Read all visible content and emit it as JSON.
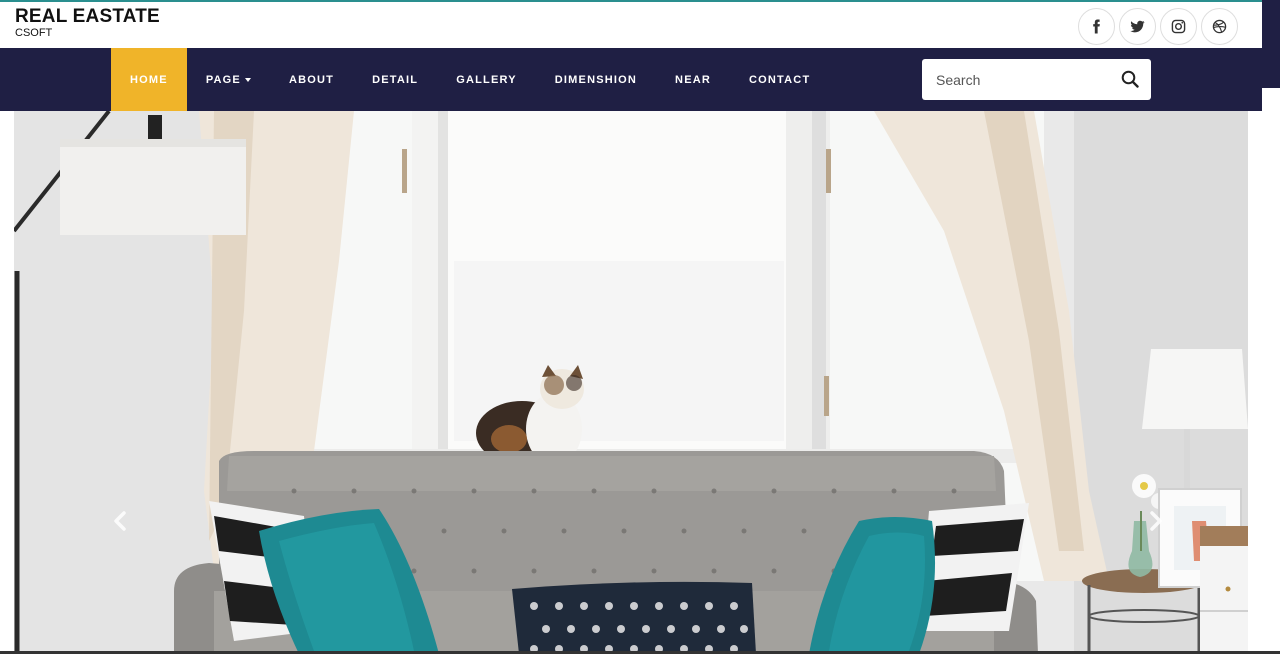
{
  "brand": {
    "title": "REAL EASTATE",
    "subtitle": "CSOFT"
  },
  "social": [
    {
      "name": "facebook-icon"
    },
    {
      "name": "twitter-icon"
    },
    {
      "name": "instagram-icon"
    },
    {
      "name": "dribbble-icon"
    }
  ],
  "nav": {
    "items": [
      {
        "label": "HOME",
        "active": true
      },
      {
        "label": "PAGE",
        "dropdown": true
      },
      {
        "label": "ABOUT"
      },
      {
        "label": "DETAIL"
      },
      {
        "label": "GALLERY"
      },
      {
        "label": "DIMENSHION"
      },
      {
        "label": "NEAR"
      },
      {
        "label": "CONTACT"
      }
    ]
  },
  "search": {
    "placeholder": "Search"
  },
  "colors": {
    "nav_bg": "#1f1f44",
    "accent": "#f0b429"
  },
  "hero": {
    "image": "living-room-sofa-cat-photo"
  }
}
